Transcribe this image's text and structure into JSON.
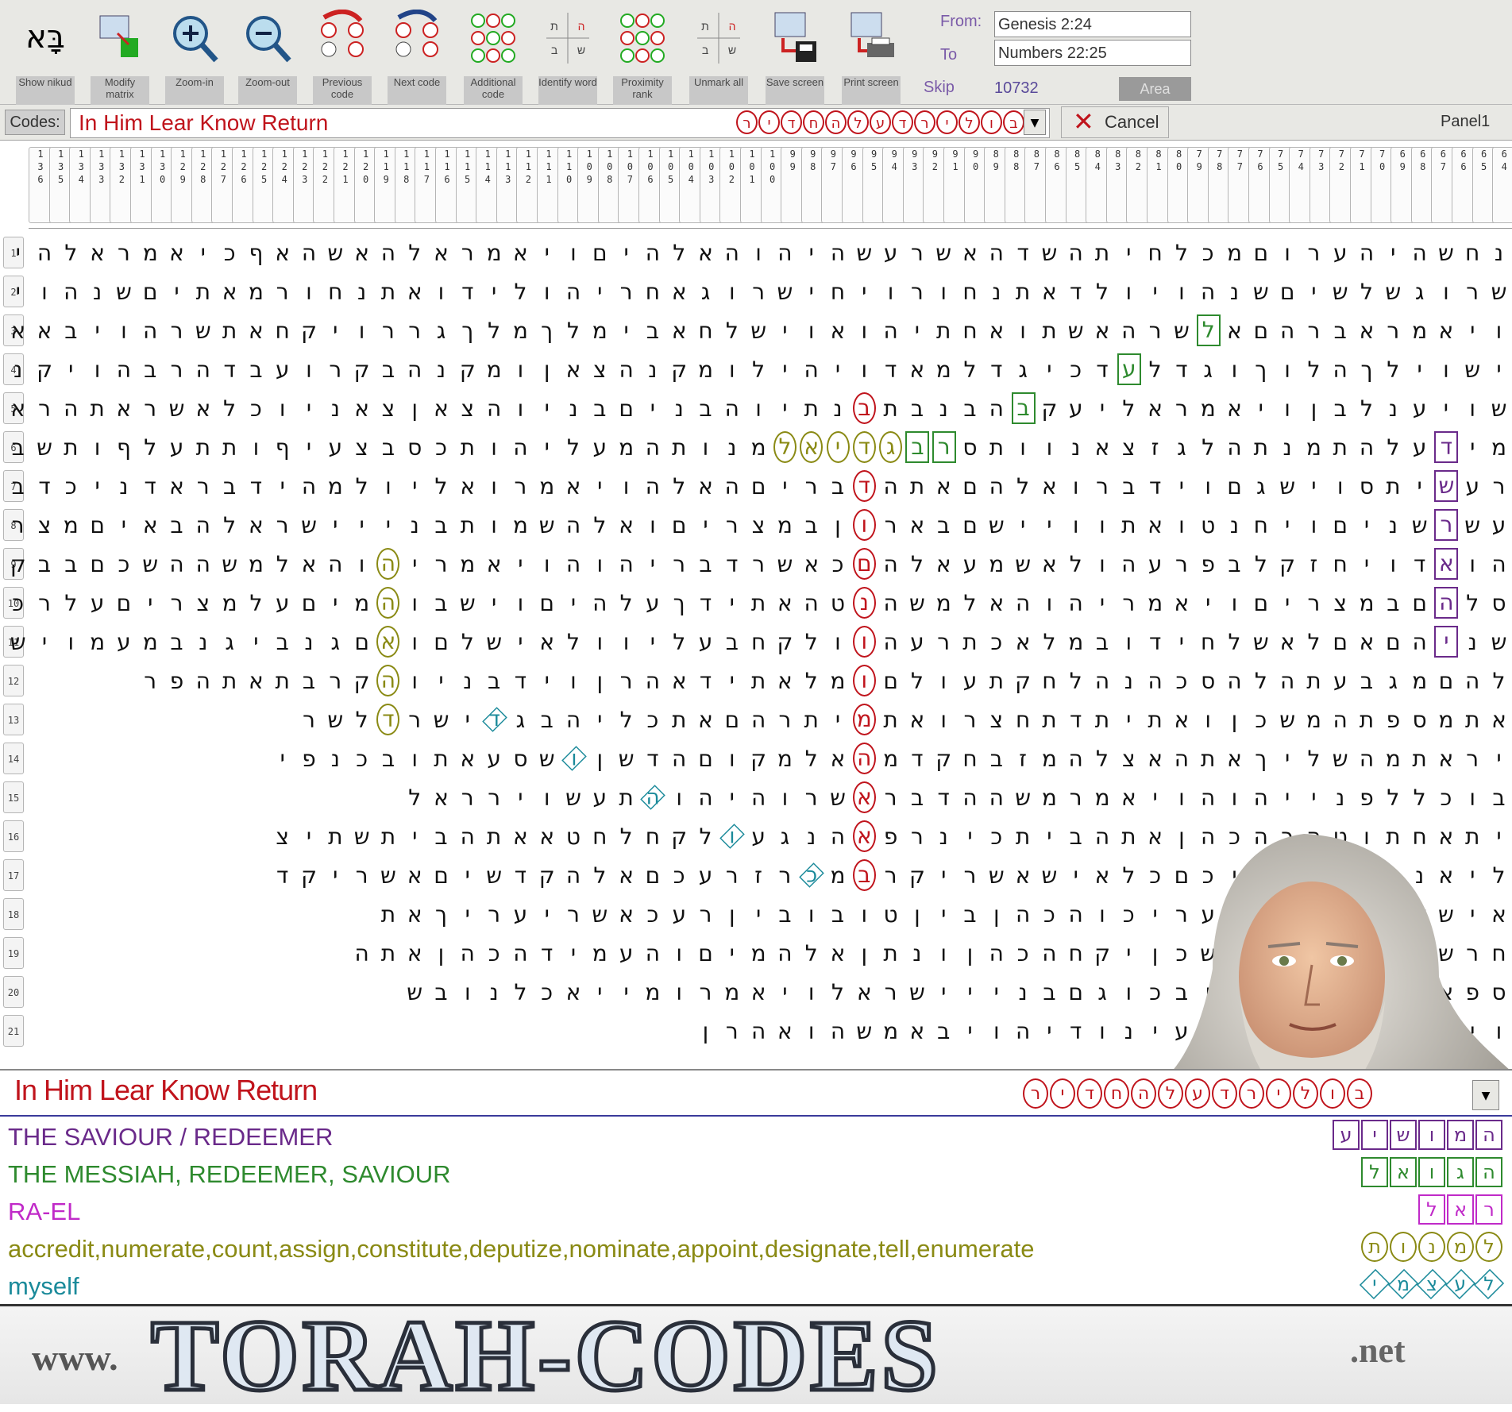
{
  "toolbar": {
    "buttons": [
      {
        "label": "Show nikud",
        "icon": "nikud-icon"
      },
      {
        "label": "Modify matrix",
        "icon": "modify-matrix-icon"
      },
      {
        "label": "Zoom-in",
        "icon": "zoom-in-icon"
      },
      {
        "label": "Zoom-out",
        "icon": "zoom-out-icon"
      },
      {
        "label": "Previous code",
        "icon": "previous-code-icon"
      },
      {
        "label": "Next code",
        "icon": "next-code-icon"
      },
      {
        "label": "Additional code",
        "icon": "additional-code-icon"
      },
      {
        "label": "Identify word",
        "icon": "identify-word-icon"
      },
      {
        "label": "Proximity rank",
        "icon": "proximity-rank-icon"
      },
      {
        "label": "Unmark all",
        "icon": "unmark-all-icon"
      },
      {
        "label": "Save screen",
        "icon": "save-screen-icon"
      },
      {
        "label": "Print screen",
        "icon": "print-screen-icon"
      }
    ],
    "range": {
      "from_label": "From:",
      "from_value": "Genesis 2:24",
      "to_label": "To",
      "to_value": "Numbers 22:25",
      "skip_label": "Skip",
      "skip_value": "10732",
      "area_label": "Area"
    }
  },
  "codes_bar": {
    "caption": "Codes:",
    "value": "In Him Lear Know Return",
    "letters": [
      "ב",
      "ו",
      "ל",
      "י",
      "ר",
      "ד",
      "ע",
      "ל",
      "ה",
      "ח",
      "ד",
      "י",
      "ר"
    ],
    "cancel_label": "Cancel",
    "panel_label": "Panel1"
  },
  "matrix": {
    "columns": [
      "136",
      "135",
      "134",
      "133",
      "132",
      "131",
      "130",
      "129",
      "128",
      "127",
      "126",
      "125",
      "124",
      "123",
      "122",
      "121",
      "120",
      "119",
      "118",
      "117",
      "116",
      "115",
      "114",
      "113",
      "112",
      "111",
      "110",
      "109",
      "108",
      "107",
      "106",
      "105",
      "104",
      "103",
      "102",
      "101",
      "100",
      "99",
      "98",
      "97",
      "96",
      "95",
      "94",
      "93",
      "92",
      "91",
      "90",
      "89",
      "88",
      "87",
      "86",
      "85",
      "84",
      "83",
      "82",
      "81",
      "80",
      "79",
      "78",
      "77",
      "76",
      "75",
      "74",
      "73",
      "72",
      "71",
      "70",
      "69",
      "68",
      "67",
      "66",
      "65",
      "64",
      "63"
    ],
    "rows": [
      "נחשהיהערוםמכלחיתהשדהאשרעשהיהוהאלהיםויאמראלהאשהאףכיאמראלהי",
      "שרוגשלשיםשנהויולדאתנחורויחישרוגאחריהולידואתנחורמאתיםשנהוי",
      "ויאמראברהםאלשרהאשתואחתיהואוישלחאבימלךמלךגררויקחאתשרהויבאא",
      "ישוילךהלוךוגדלעדכיגדלמאדויהילומקנהצאןומקנהבקרועבדהרבהויקנ",
      "שויענלבןויאמראליעקבהבנבתבנתיוהבניםבניוהצאןצאניוכלאשראתהרא",
      "מידעלהתמנתהלגזצאנוותסרבגדיאלמנותהמעליהותכסבצעיףותתעלףותשב",
      "רעשיתסוישגםוידברואלהםאתהדבריםהאלהויאמרואליולמהידבראדניכדבר",
      "עשרשניםויחנטואתוויישםבארוןבמצריםואלהשמותבנייישראלהבאיםמצרי",
      "הואדויחזקלבפרעהולאשמעאלהםכאשרדבריהוהויאמריהוהאלמשההשכםבבקר",
      "סלהםבמצריםויאמריהוהאלמשהנטהאתידךעלהיםוישבוהמיםעלמצריםעלרכ",
      "שניהםאםלאשלחידובמלאכתרעהוולקחבעליוולאישלםואםגנביגנבמעמויש",
      "להםמגבעתהלהסכהנהלחקתעולםומלאתידאהרןוידבניוהקרבתאתהפר",
      "אתמספתהמשכןואתיתדתחצרואתמיתרהםאתכליהבגדישרדלשר",
      "יראתמהשליךאתהאצלהמזבחקדמהאלמקוםהדשןושסעאתובכנפי",
      "בוכללפנייהוהויאמרמשההדבראשרוהיהוהתעשוירראל",
      "יתאחתוטהרהכהןאתהביתכינרפאהנגעולקחלחטאאתהביתשתיצ",
      "ליאנהסלדרתיכםכלאישאשריקרבמכרזרעכםאלהקדשיםאשריקד",
      "אישקדשליהוהעריכוהכהןביןטובוביןרעכאשריעריךאת",
      "חרשהבקרקעהמשכןיקחהכהןונתןאלהמיםוהעמידהכהןאתה",
      "ספאוהוישבוויבכוגםבנייישראלויאמרומייאכלנובש",
      "ויעדוהנהכסהועינודיהויבאמשהואהרן"
    ]
  },
  "result": {
    "code_title": "In Him Lear Know Return",
    "letters": [
      "ב",
      "ו",
      "ל",
      "י",
      "ר",
      "ד",
      "ע",
      "ל",
      "ה",
      "ח",
      "ד",
      "י",
      "ר"
    ]
  },
  "legend": [
    {
      "text": "THE SAVIOUR / REDEEMER",
      "color": "#6a2a8a",
      "letters": [
        "ה",
        "מ",
        "ו",
        "ש",
        "י",
        "ע"
      ],
      "shape": "square"
    },
    {
      "text": "THE MESSIAH, REDEEMER, SAVIOUR",
      "color": "#2e8a2e",
      "letters": [
        "ה",
        "ג",
        "ו",
        "א",
        "ל"
      ],
      "shape": "square"
    },
    {
      "text": "RA-EL",
      "color": "#c02ac8",
      "letters": [
        "ר",
        "א",
        "ל"
      ],
      "shape": "square"
    },
    {
      "text": "accredit,numerate,count,assign,constitute,deputize,nominate,appoint,designate,tell,enumerate",
      "color": "#8a8a14",
      "letters": [
        "ל",
        "מ",
        "נ",
        "ו",
        "ת"
      ],
      "shape": "oval"
    },
    {
      "text": "myself",
      "color": "#1a8a9a",
      "letters": [
        "ל",
        "ע",
        "צ",
        "מ",
        "י"
      ],
      "shape": "diamond"
    }
  ],
  "banner": {
    "prefix": "www.",
    "main": "TORAH-CODES",
    "suffix": ".net"
  },
  "colors": {
    "code_red": "#c0141c",
    "saviour": "#6a2a8a",
    "messiah": "#2e8a2e",
    "rael": "#c02ac8",
    "numerate": "#8a8a14",
    "myself": "#1a8a9a"
  }
}
